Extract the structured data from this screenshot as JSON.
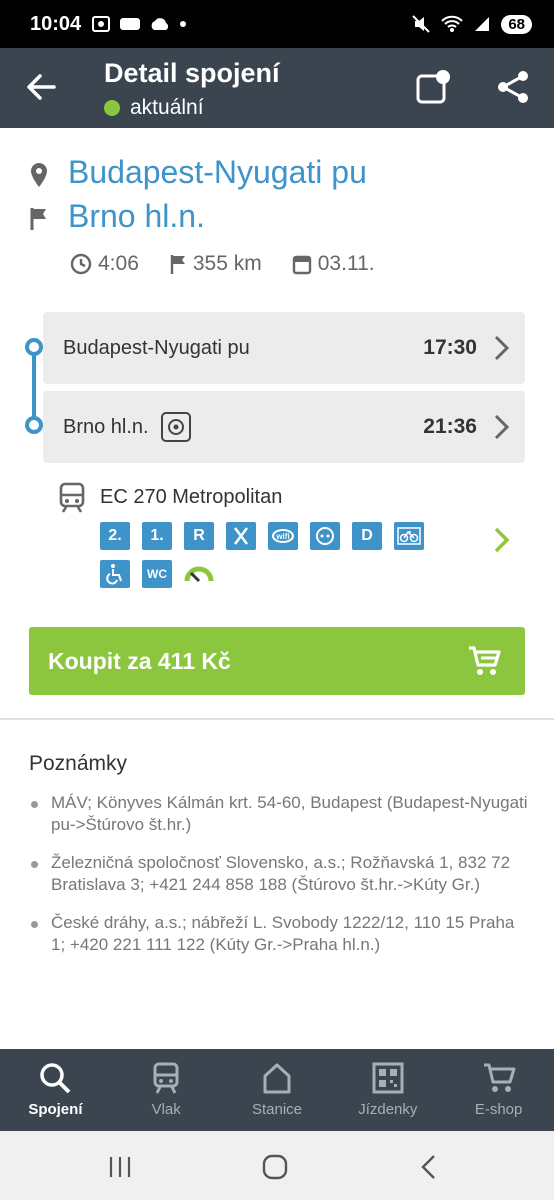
{
  "status": {
    "time": "10:04",
    "battery": "68"
  },
  "appbar": {
    "title": "Detail spojení",
    "status": "aktuální",
    "status_color": "#8cc63f"
  },
  "route": {
    "from": "Budapest-Nyugati pu",
    "to": "Brno hl.n.",
    "duration": "4:06",
    "distance": "355 km",
    "date": "03.11."
  },
  "legs": [
    {
      "station": "Budapest-Nyugati pu",
      "time": "17:30"
    },
    {
      "station": "Brno hl.n.",
      "time": "21:36"
    }
  ],
  "train": {
    "name": "EC 270 Metropolitan",
    "badges": [
      "2.",
      "1.",
      "R",
      "restaurant-icon",
      "wifi-icon",
      "socket-icon",
      "D",
      "bicycle-icon",
      "wheelchair-icon",
      "WC",
      "speedometer-icon"
    ]
  },
  "buy": {
    "label": "Koupit za 411 Kč"
  },
  "notes": {
    "heading": "Poznámky",
    "items": [
      "MÁV; Könyves Kálmán krt. 54-60, Budapest (Budapest-Nyugati pu->Štúrovo št.hr.)",
      "Železničná spoločnosť Slovensko, a.s.; Rožňavská 1, 832 72 Bratislava 3; +421 244 858 188 (Štúrovo št.hr.->Kúty Gr.)",
      "České dráhy, a.s.; nábřeží L. Svobody 1222/12, 110 15 Praha 1; +420 221 111 122 (Kúty Gr.->Praha hl.n.)"
    ]
  },
  "tabs": [
    {
      "label": "Spojení",
      "icon": "search-icon",
      "active": true
    },
    {
      "label": "Vlak",
      "icon": "train-icon",
      "active": false
    },
    {
      "label": "Stanice",
      "icon": "station-icon",
      "active": false
    },
    {
      "label": "Jízdenky",
      "icon": "qr-icon",
      "active": false
    },
    {
      "label": "E-shop",
      "icon": "cart-icon",
      "active": false
    }
  ],
  "colors": {
    "accent": "#3e93c9",
    "green": "#8cc63f",
    "appbar": "#3a4550"
  }
}
